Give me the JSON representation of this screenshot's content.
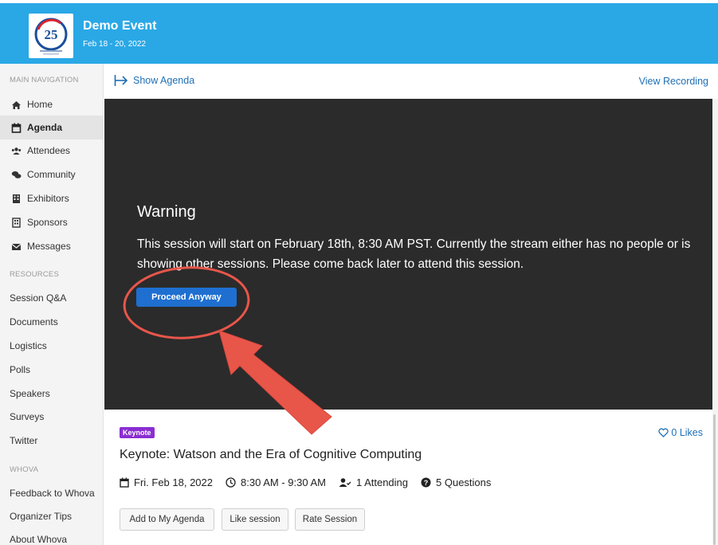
{
  "event": {
    "title": "Demo Event",
    "dates": "Feb 18 - 20, 2022"
  },
  "sidebar": {
    "main_nav_label": "MAIN NAVIGATION",
    "items": [
      {
        "label": "Home",
        "icon": "home-icon"
      },
      {
        "label": "Agenda",
        "icon": "calendar-icon",
        "active": true
      },
      {
        "label": "Attendees",
        "icon": "users-icon"
      },
      {
        "label": "Community",
        "icon": "chat-icon"
      },
      {
        "label": "Exhibitors",
        "icon": "building-icon"
      },
      {
        "label": "Sponsors",
        "icon": "sponsor-icon"
      },
      {
        "label": "Messages",
        "icon": "envelope-icon"
      }
    ],
    "resources_label": "RESOURCES",
    "resources": [
      "Session Q&A",
      "Documents",
      "Logistics",
      "Polls",
      "Speakers",
      "Surveys",
      "Twitter"
    ],
    "whova_label": "WHOVA",
    "whova": [
      "Feedback to Whova",
      "Organizer Tips",
      "About Whova"
    ]
  },
  "topbar": {
    "show_agenda": "Show Agenda",
    "view_recording": "View Recording"
  },
  "warning": {
    "title": "Warning",
    "message": "This session will start on February 18th, 8:30 AM PST. Currently the stream either has no people or is showing other sessions. Please come back later to attend this session.",
    "button": "Proceed Anyway"
  },
  "session": {
    "badge": "Keynote",
    "likes": "0 Likes",
    "title": "Keynote: Watson and the Era of Cognitive Computing",
    "date": "Fri. Feb 18, 2022",
    "time": "8:30 AM - 9:30 AM",
    "attending": "1 Attending",
    "questions": "5 Questions",
    "buttons": {
      "add": "Add to My Agenda",
      "like": "Like session",
      "rate": "Rate Session"
    }
  },
  "colors": {
    "header": "#2aa8e6",
    "link": "#1f6fb5",
    "panel": "#2b2b2b",
    "primary_button": "#1f6fd0",
    "annotation": "#e8564a",
    "badge": "#8a2ed2"
  }
}
